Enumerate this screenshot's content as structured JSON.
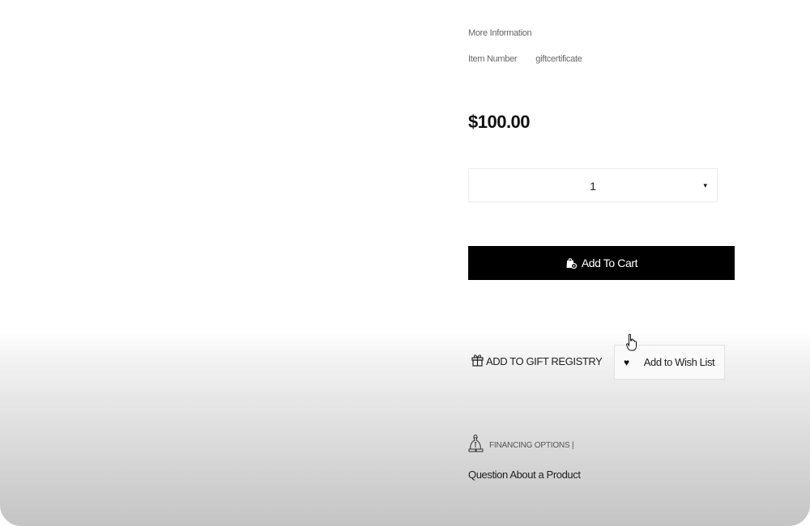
{
  "product": {
    "more_information_label": "More Information",
    "item_number_label": "Item Number",
    "item_number_value": "giftcertificate",
    "price": "$100.00"
  },
  "quantity_select": {
    "selected": "1",
    "arrow": "▾"
  },
  "actions": {
    "add_to_cart_label": "Add To Cart",
    "add_to_gift_registry_label": "ADD TO GIFT REGISTRY",
    "add_to_wish_list_label": "Add to Wish List",
    "wish_heart": "♥"
  },
  "links": {
    "financing_options_label": "FINANCING OPTIONS |",
    "question_label": "Question About a Product"
  },
  "icons": {
    "cart": "shopping-bag-icon",
    "gift": "gift-icon",
    "wish": "heart-icon",
    "financing": "money-bag-icon",
    "cursor": "hand-pointer-cursor"
  },
  "colors": {
    "button_bg": "#000000",
    "button_text": "#ffffff"
  }
}
